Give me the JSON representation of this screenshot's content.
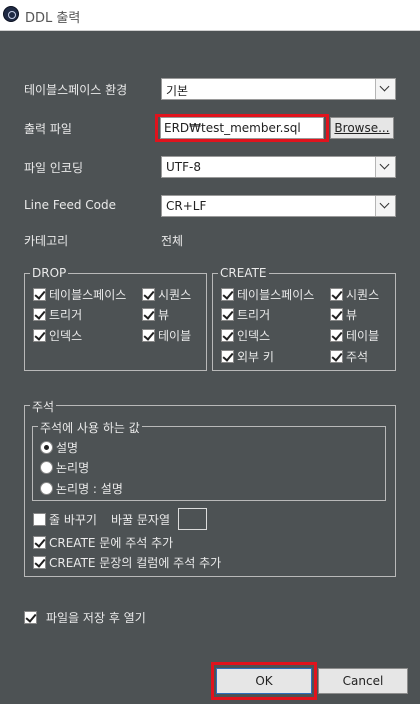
{
  "window": {
    "title": "DDL 출력"
  },
  "form": {
    "tablespace_env": {
      "label": "테이블스페이스 환경",
      "value": "기본"
    },
    "output_file": {
      "label": "출력 파일",
      "value": "ERD₩test_member.sql",
      "browse_label": "Browse..."
    },
    "file_encoding": {
      "label": "파일 인코딩",
      "value": "UTF-8"
    },
    "line_feed": {
      "label": "Line Feed Code",
      "value": "CR+LF"
    },
    "category": {
      "label": "카테고리",
      "value": "전체"
    }
  },
  "drop_group": {
    "title": "DROP",
    "items": [
      {
        "label": "테이블스페이스",
        "checked": true
      },
      {
        "label": "시퀀스",
        "checked": true
      },
      {
        "label": "트리거",
        "checked": true
      },
      {
        "label": "뷰",
        "checked": true
      },
      {
        "label": "인덱스",
        "checked": true
      },
      {
        "label": "테이블",
        "checked": true
      }
    ]
  },
  "create_group": {
    "title": "CREATE",
    "items": [
      {
        "label": "테이블스페이스",
        "checked": true
      },
      {
        "label": "시퀀스",
        "checked": true
      },
      {
        "label": "트리거",
        "checked": true
      },
      {
        "label": "뷰",
        "checked": true
      },
      {
        "label": "인덱스",
        "checked": true
      },
      {
        "label": "테이블",
        "checked": true
      },
      {
        "label": "외부 키",
        "checked": true
      },
      {
        "label": "주석",
        "checked": true
      }
    ]
  },
  "comment_group": {
    "title": "주석",
    "value_group": {
      "title": "주석에 사용 하는 값",
      "options": [
        {
          "label": "설명",
          "selected": true
        },
        {
          "label": "논리명",
          "selected": false
        },
        {
          "label": "논리명 : 설명",
          "selected": false
        }
      ]
    },
    "line_break": {
      "label": "줄 바꾸기",
      "checked": false
    },
    "replace_string": {
      "label": "바꿀 문자열",
      "value": ""
    },
    "create_comment": {
      "label": "CREATE 문에 주석 추가",
      "checked": true
    },
    "create_column_comment": {
      "label": "CREATE 문장의 컬럼에 주석 추가",
      "checked": true
    }
  },
  "open_after_save": {
    "label": "파일을 저장 후 열기",
    "checked": true
  },
  "buttons": {
    "ok": "OK",
    "cancel": "Cancel"
  },
  "colors": {
    "background": "#4d5254",
    "highlight": "#e0131d",
    "ok_border": "#2d6fbd"
  }
}
